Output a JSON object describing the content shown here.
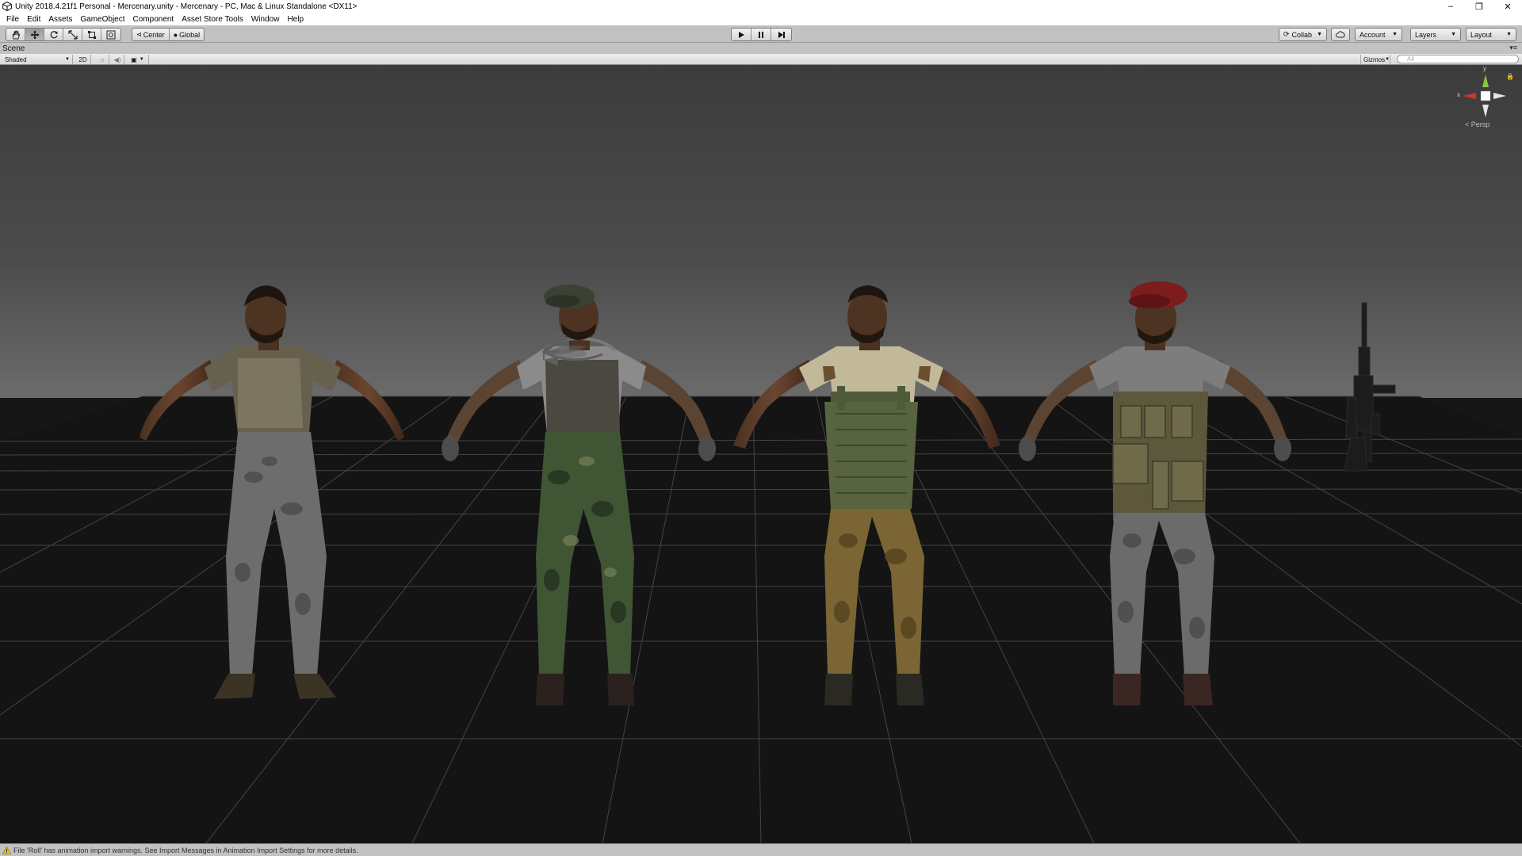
{
  "window": {
    "title": "Unity 2018.4.21f1 Personal - Mercenary.unity - Mercenary - PC, Mac & Linux Standalone <DX11>",
    "controls": [
      "–",
      "❐",
      "✕"
    ]
  },
  "menu": {
    "items": [
      "File",
      "Edit",
      "Assets",
      "GameObject",
      "Component",
      "Asset Store Tools",
      "Window",
      "Help"
    ]
  },
  "toolbar": {
    "transform_tools": [
      "hand-icon",
      "move-icon",
      "rotate-icon",
      "scale-icon",
      "rect-icon",
      "transform-icon"
    ],
    "active_tool": "move-icon",
    "pivot_label": "Center",
    "space_label": "Global",
    "play_controls": [
      "play-icon",
      "pause-icon",
      "step-icon"
    ],
    "collab_label": "Collab",
    "account_label": "Account",
    "layers_label": "Layers",
    "layout_label": "Layout"
  },
  "scene": {
    "tab_label": "Scene",
    "shading_mode": "Shaded",
    "mode_2d_label": "2D",
    "gizmos_label": "Gizmos",
    "search_placeholder": "All",
    "projection_label": "Persp",
    "axis_labels": {
      "x": "x",
      "y": "y"
    },
    "objects": [
      {
        "name": "mercenary-casual",
        "headwear": "none",
        "pants": "grey-camo",
        "vest": "none"
      },
      {
        "name": "mercenary-green-beret",
        "headwear": "green-beret",
        "pants": "green-camo",
        "vest": "grey"
      },
      {
        "name": "mercenary-plate-carrier",
        "headwear": "none",
        "pants": "tan-camo",
        "vest": "olive-plate-carrier"
      },
      {
        "name": "mercenary-red-beret",
        "headwear": "red-beret",
        "pants": "grey-camo",
        "vest": "tactical-rig"
      },
      {
        "name": "assault-rifle",
        "kind": "rifle"
      }
    ],
    "colors": {
      "sky_top": "#404040",
      "sky_horizon": "#666666",
      "ground": "#121212",
      "grid": "#4a4a4a",
      "gizmo_x": "#d9342b",
      "gizmo_y": "#8cc63f",
      "gizmo_z": "#3b6ec8"
    }
  },
  "status": {
    "message": "File 'Roll' has animation import warnings. See Import Messages in Animation Import Settings for more details."
  }
}
